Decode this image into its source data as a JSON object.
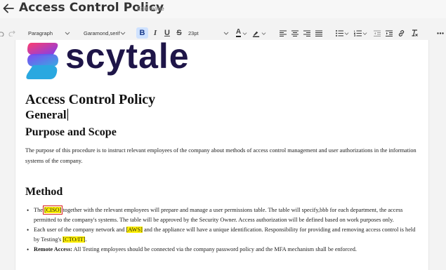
{
  "header": {
    "back_icon": "arrow-left-icon",
    "title": "Access Control Policy",
    "mode": "Edit mode"
  },
  "toolbar": {
    "paragraph_style": "Paragraph",
    "font_family": "Garamond,serif",
    "font_size": "23pt",
    "bold": "B",
    "italic": "I",
    "underline": "U",
    "strikethrough": "S",
    "text_color": "A",
    "icons": [
      "undo-icon",
      "redo-icon",
      "bold-icon",
      "italic-icon",
      "underline-icon",
      "strikethrough-icon",
      "text-color-icon",
      "highlight-icon",
      "align-left-icon",
      "align-center-icon",
      "align-right-icon",
      "align-justify-icon",
      "bullet-list-icon",
      "numbered-list-icon",
      "outdent-icon",
      "indent-icon",
      "link-icon",
      "clear-format-icon",
      "more-icon"
    ],
    "active_color": "#cfe2ff"
  },
  "document": {
    "logo_text": "scytale",
    "logo_colors": [
      "#ff3d6e",
      "#7b3ff2",
      "#2aa8e0",
      "#1e1548"
    ],
    "title": "Access Control Policy",
    "general": "General",
    "purpose_heading": "Purpose and Scope",
    "purpose_text": "The purpose of this procedure is to instruct relevant employees of the company about methods of access control management and user authorizations in the information systems of the company.",
    "method_heading": "Method",
    "bullets": [
      {
        "pre": "The ",
        "tag": "[CISO]",
        "post": " together with the relevant employees will prepare and manage a user permissions table. The table will specify,bbb for each department, the access permitted to the company's systems. The table will be approved by the Security Owner. Access authorization will be defined based on work purposes only."
      },
      {
        "pre": "Each user of the company network and ",
        "tag": "[AWS]",
        "mid": " and the appliance will have a unique identification. Responsibility for providing and removing access control is held by Testing's ",
        "tag2": "[CTO/IT]",
        "post": "."
      },
      {
        "bold": "Remote Access:",
        "post": " All Testing employees should be connected via the company password policy and the MFA mechanism shall be enforced."
      }
    ],
    "highlight_color": "#fff000",
    "box_color": "#d81e1e"
  }
}
